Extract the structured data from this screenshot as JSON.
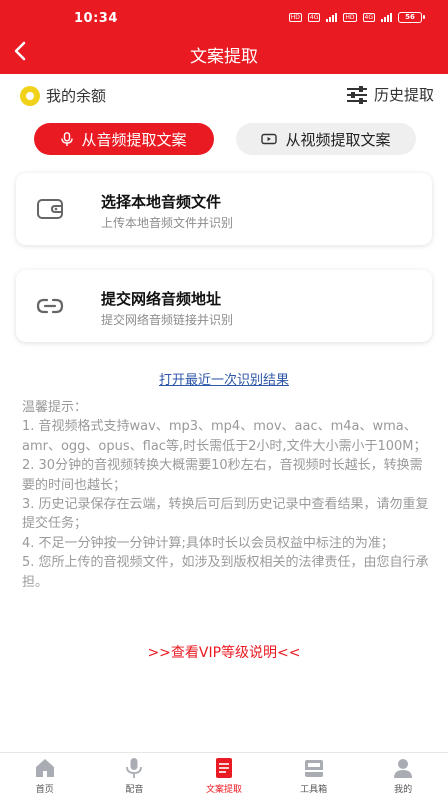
{
  "status_bar": {
    "time": "10:34",
    "network_tags": [
      "HD",
      "4G",
      "HD",
      "4G"
    ],
    "battery": "56"
  },
  "header": {
    "title": "文案提取",
    "back_icon": "chevron-left-icon"
  },
  "top_links": {
    "balance_label": "我的余额",
    "history_label": "历史提取"
  },
  "tabs": [
    {
      "label": "从音频提取文案",
      "icon": "microphone-icon",
      "active": true
    },
    {
      "label": "从视频提取文案",
      "icon": "video-icon",
      "active": false
    }
  ],
  "cards": {
    "local": {
      "title": "选择本地音频文件",
      "subtitle": "上传本地音频文件并识别",
      "icon": "wallet-icon"
    },
    "network": {
      "title": "提交网络音频地址",
      "subtitle": "提交网络音频链接并识别",
      "icon": "link-icon"
    }
  },
  "recent_link": "打开最近一次识别结果",
  "tips": {
    "heading": "温馨提示：",
    "lines": [
      "1. 音视频格式支持wav、mp3、mp4、mov、aac、m4a、wma、amr、ogg、opus、flac等,时长需低于2小时,文件大小需小于100M；",
      "2. 30分钟的音视频转换大概需要10秒左右，音视频时长越长，转换需要的时间也越长；",
      "3. 历史记录保存在云端，转换后可后到历史记录中查看结果，请勿重复提交任务；",
      "4. 不足一分钟按一分钟计算;具体时长以会员权益中标注的为准；",
      "5. 您所上传的音视频文件，如涉及到版权相关的法律责任，由您自行承担。"
    ]
  },
  "vip_link": ">>查看VIP等级说明<<",
  "bottom_nav": [
    {
      "label": "首页",
      "icon": "home-icon",
      "active": false
    },
    {
      "label": "配音",
      "icon": "microphone-icon",
      "active": false
    },
    {
      "label": "文案提取",
      "icon": "document-icon",
      "active": true
    },
    {
      "label": "工具箱",
      "icon": "toolbox-icon",
      "active": false
    },
    {
      "label": "我的",
      "icon": "user-icon",
      "active": false
    }
  ],
  "colors": {
    "accent": "#ea1a22",
    "link": "#2d56a8",
    "coin": "#f0d21b",
    "muted_text": "#9a9a9a"
  }
}
